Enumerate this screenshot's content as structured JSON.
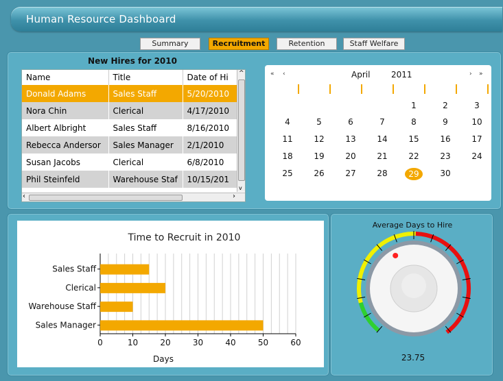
{
  "app": {
    "title": "Human Resource Dashboard"
  },
  "tabs": [
    {
      "label": "Summary",
      "active": false
    },
    {
      "label": "Recruitment",
      "active": true
    },
    {
      "label": "Retention",
      "active": false
    },
    {
      "label": "Staff Welfare",
      "active": false
    }
  ],
  "hires": {
    "title": "New Hires for 2010",
    "columns": [
      "Name",
      "Title",
      "Date of Hi"
    ],
    "rows": [
      {
        "name": "Donald Adams",
        "title": "Sales Staff",
        "date": "5/20/2010",
        "selected": true
      },
      {
        "name": "Nora Chin",
        "title": "Clerical",
        "date": "4/17/2010"
      },
      {
        "name": "Albert Albright",
        "title": "Sales Staff",
        "date": "8/16/2010"
      },
      {
        "name": "Rebecca Andersor",
        "title": "Sales Manager",
        "date": "2/1/2010"
      },
      {
        "name": "Susan Jacobs",
        "title": "Clerical",
        "date": "6/8/2010"
      },
      {
        "name": "Phil Steinfeld",
        "title": "Warehouse Staf",
        "date": "10/15/201"
      }
    ]
  },
  "calendar": {
    "month": "April",
    "year": "2011",
    "nav_prev_year": "«",
    "nav_prev": "‹",
    "nav_next": "›",
    "nav_next_year": "»",
    "weeks": [
      [
        "",
        "",
        "",
        "",
        "1",
        "2",
        "3"
      ],
      [
        "4",
        "5",
        "6",
        "7",
        "8",
        "9",
        "10"
      ],
      [
        "11",
        "12",
        "13",
        "14",
        "15",
        "16",
        "17"
      ],
      [
        "18",
        "19",
        "20",
        "21",
        "22",
        "23",
        "24"
      ],
      [
        "25",
        "26",
        "27",
        "28",
        "29",
        "30",
        ""
      ]
    ],
    "selected_day": "29"
  },
  "chart_data": {
    "type": "bar",
    "title": "Time to Recruit in 2010",
    "categories": [
      "Sales Staff",
      "Clerical",
      "Warehouse Staff",
      "Sales Manager"
    ],
    "values": [
      15,
      20,
      10,
      50
    ],
    "xlabel": "Days",
    "xlim": [
      0,
      60
    ],
    "xticks": [
      0,
      10,
      20,
      30,
      40,
      50,
      60
    ],
    "grid": true,
    "orientation": "horizontal",
    "bar_color": "#f3a800"
  },
  "gauge": {
    "title": "Average Days to Hire",
    "value_label": "23.75",
    "value": 23.75,
    "range_colors": [
      "#2fd02f",
      "#f0f000",
      "#e81010"
    ]
  },
  "colors": {
    "accent": "#f3a800",
    "background": "#4a96ad",
    "panel": "#5aaec5"
  }
}
